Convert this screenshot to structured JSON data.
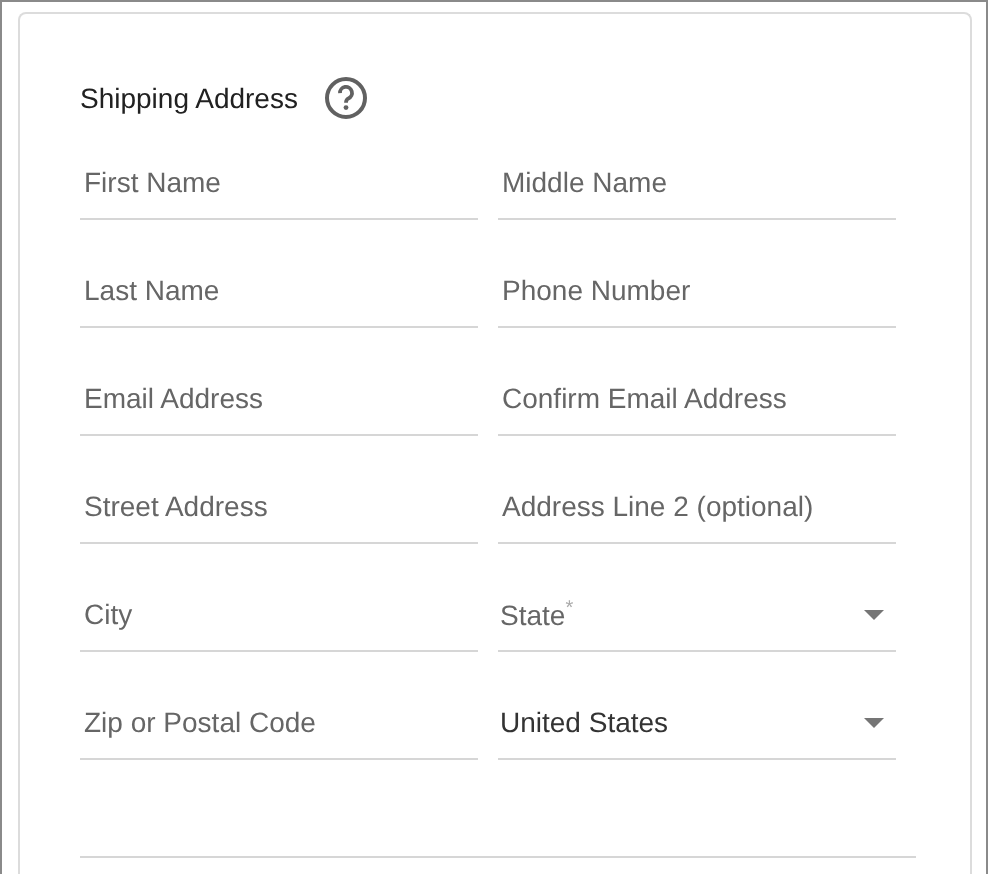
{
  "section": {
    "title": "Shipping Address"
  },
  "fields": [
    {
      "kind": "text",
      "placeholder": "First Name"
    },
    {
      "kind": "text",
      "placeholder": "Middle Name"
    },
    {
      "kind": "text",
      "placeholder": "Last Name"
    },
    {
      "kind": "text",
      "placeholder": "Phone Number"
    },
    {
      "kind": "text",
      "placeholder": "Email Address"
    },
    {
      "kind": "text",
      "placeholder": "Confirm Email Address"
    },
    {
      "kind": "text",
      "placeholder": "Street Address"
    },
    {
      "kind": "text",
      "placeholder": "Address Line 2 (optional)"
    },
    {
      "kind": "text",
      "placeholder": "City"
    },
    {
      "kind": "select",
      "placeholder": "State$^{*}$"
    },
    {
      "kind": "text",
      "placeholder": "Zip or Postal Code"
    },
    {
      "kind": "select",
      "value": "United States"
    }
  ]
}
